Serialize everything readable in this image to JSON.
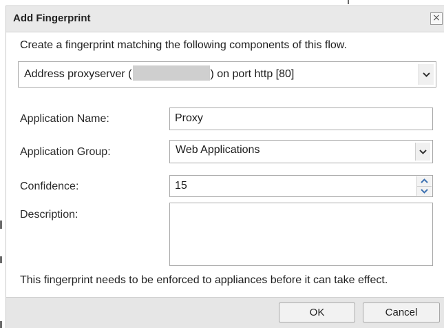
{
  "dialog": {
    "title": "Add Fingerprint",
    "close_glyph": "×",
    "intro_text": "Create a fingerprint matching the following components of this flow.",
    "address_select": {
      "prefix": "Address proxyserver (",
      "suffix": ") on port http [80]"
    },
    "fields": {
      "application_name": {
        "label": "Application Name:",
        "value": "Proxy"
      },
      "application_group": {
        "label": "Application Group:",
        "value": "Web Applications"
      },
      "confidence": {
        "label": "Confidence:",
        "value": "15"
      },
      "description": {
        "label": "Description:",
        "value": ""
      }
    },
    "footer_note": "This fingerprint needs to be enforced to appliances before it can take effect.",
    "buttons": {
      "ok": "OK",
      "cancel": "Cancel"
    }
  },
  "icons": {
    "close": "close-icon",
    "dropdown": "chevron-down-icon",
    "spinner_up": "spinner-up-icon",
    "spinner_down": "spinner-down-icon"
  },
  "colors": {
    "titlebar": "#e9e9e9",
    "buttonbar": "#e6e6e6",
    "field_border": "#a9a9a9",
    "spinner_arrow": "#3a6fb0"
  }
}
